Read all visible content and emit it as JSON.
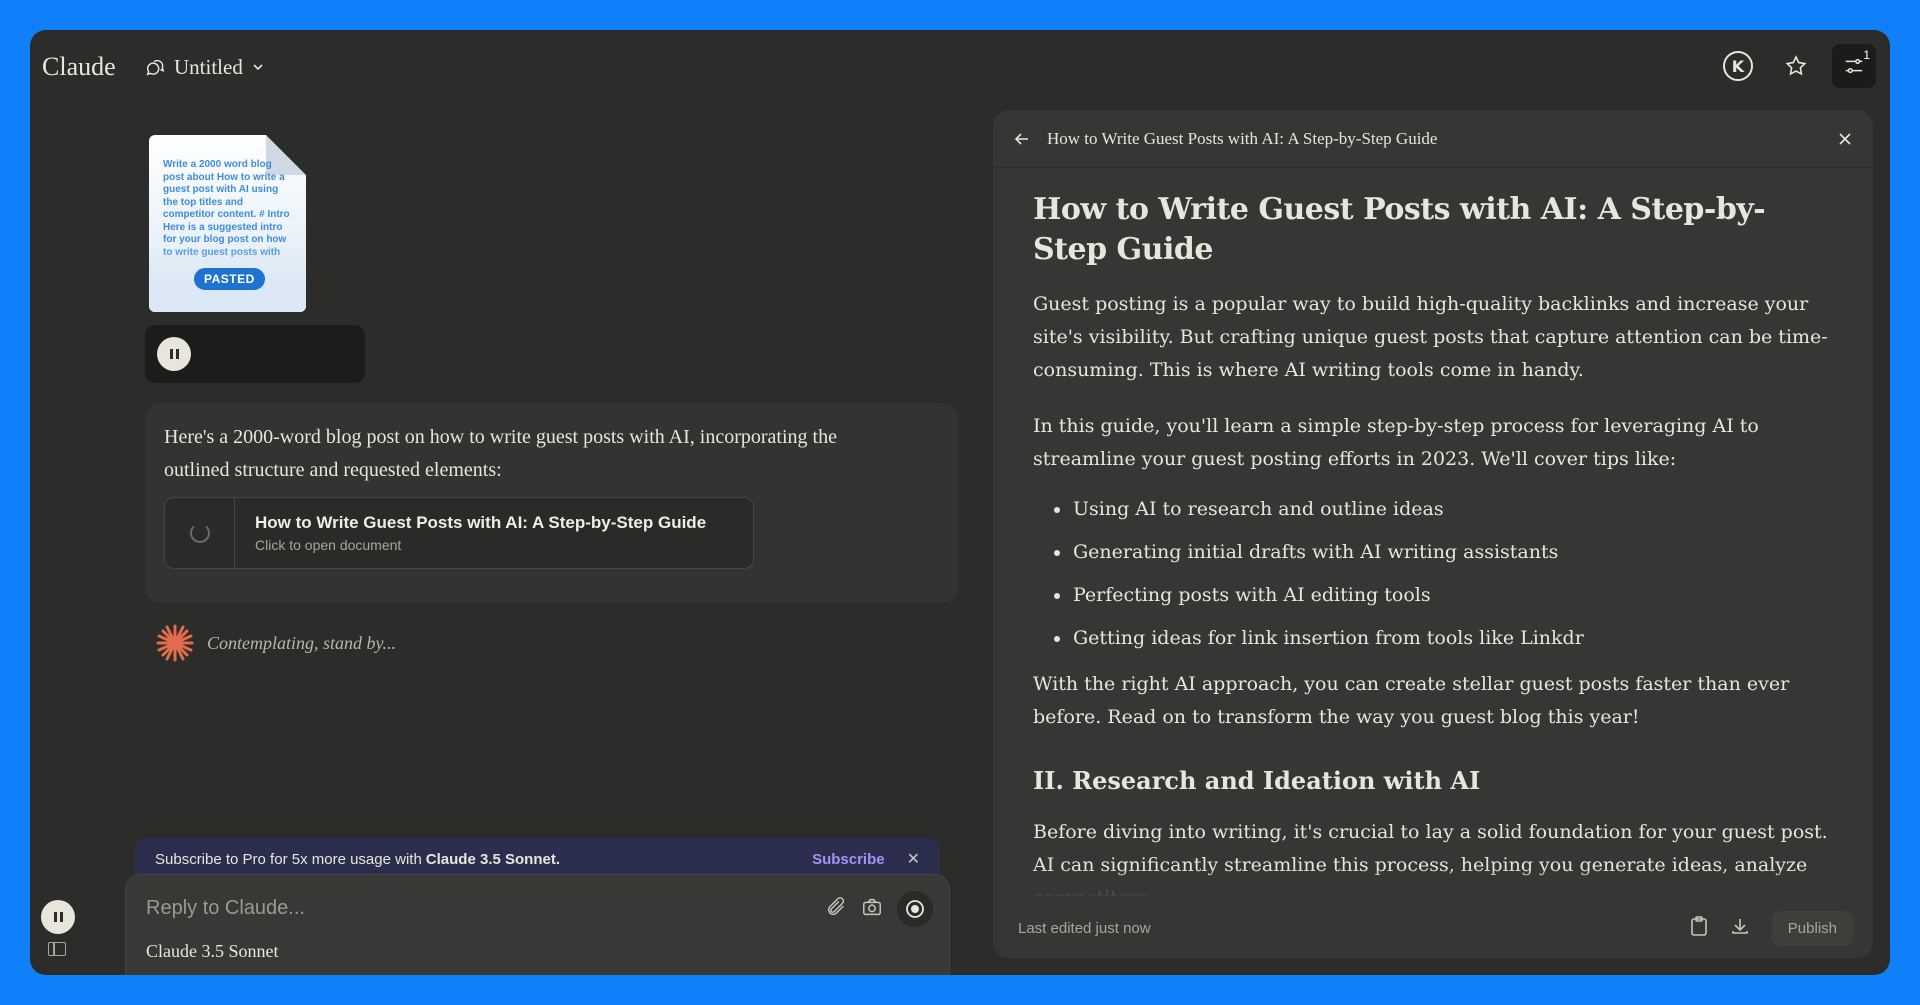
{
  "header": {
    "brand": "Claude",
    "chat_title": "Untitled",
    "settings_badge": "1",
    "avatar_letter": "K"
  },
  "pasted_doc": {
    "preview_text": "Write a 2000 word blog post about How to write a guest post with AI using the top titles and competitor content. # Intro Here is a suggested intro for your blog post on how to write guest posts with",
    "badge": "PASTED"
  },
  "message": {
    "text": "Here's a 2000-word blog post on how to write guest posts with AI, incorporating the outlined structure and requested elements:",
    "artifact_title": "How to Write Guest Posts with AI: A Step-by-Step Guide",
    "artifact_subtitle": "Click to open document"
  },
  "status": {
    "thinking": "Contemplating, stand by..."
  },
  "subscribe_banner": {
    "text": "Subscribe to Pro for 5x more usage with",
    "model": "Claude 3.5 Sonnet.",
    "link": "Subscribe"
  },
  "composer": {
    "placeholder": "Reply to Claude...",
    "model": "Claude 3.5 Sonnet"
  },
  "panel": {
    "header_title": "How to Write Guest Posts with AI: A Step-by-Step Guide",
    "doc_title": "How to Write Guest Posts with AI: A Step-by-Step Guide",
    "para1": "Guest posting is a popular way to build high-quality backlinks and increase your site's visibility. But crafting unique guest posts that capture attention can be time-consuming. This is where AI writing tools come in handy.",
    "para2": "In this guide, you'll learn a simple step-by-step process for leveraging AI to streamline your guest posting efforts in 2023. We'll cover tips like:",
    "bullets": [
      "Using AI to research and outline ideas",
      "Generating initial drafts with AI writing assistants",
      "Perfecting posts with AI editing tools",
      "Getting ideas for link insertion from tools like Linkdr"
    ],
    "para3": "With the right AI approach, you can create stellar guest posts faster than ever before. Read on to transform the way you guest blog this year!",
    "h2": "II. Research and Ideation with AI",
    "para4": "Before diving into writing, it's crucial to lay a solid foundation for your guest post. AI can significantly streamline this process, helping you generate ideas, analyze competitors",
    "footer_status": "Last edited just now",
    "publish": "Publish"
  },
  "colors": {
    "background": "#0f7ffa",
    "window": "#2c2c2a",
    "accent_purple": "#a592f5",
    "pasted_badge": "#1f73d0",
    "starburst": "#e26c4d"
  }
}
